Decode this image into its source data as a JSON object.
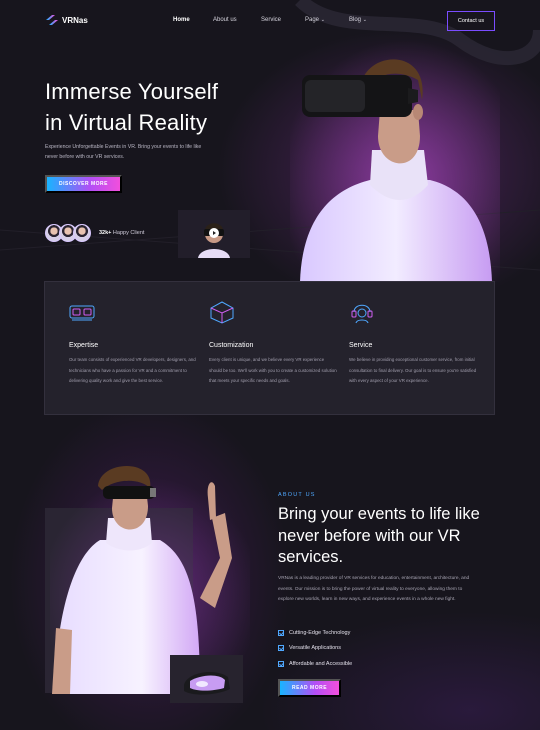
{
  "header": {
    "logo_text": "VRNas",
    "nav": [
      "Home",
      "About us",
      "Service",
      "Page",
      "Blog"
    ],
    "contact_label": "Contact us"
  },
  "hero": {
    "title_line1": "Immerse Yourself",
    "title_line2": "in Virtual Reality",
    "subtitle": "Experience Unforgettable Events in VR. Bring your events to life like never before with our VR services.",
    "cta_label": "DISCOVER MORE",
    "clients_count": "32k+",
    "clients_label": "Happy Client"
  },
  "features": [
    {
      "icon": "vr-headset-icon",
      "title": "Expertise",
      "text": "Our team consists of experienced VR developers, designers, and technicians who have a passion for VR and a commitment to delivering quality work and give the best service."
    },
    {
      "icon": "cube-icon",
      "title": "Customization",
      "text": "Every client is unique, and we believe every VR experience should be too. We'll work with you to create a customized solution that meets your specific needs and goals."
    },
    {
      "icon": "support-person-icon",
      "title": "Service",
      "text": "We believe in providing exceptional customer service, from initial consultation to final delivery. Our goal is to ensure you're satisfied with every aspect of your VR experience."
    }
  ],
  "about": {
    "tag": "ABOUT US",
    "title": "Bring your events to life like never before with our VR services.",
    "text": "VRNas is a leading provider of VR services for education, entertainment, architecture, and events. Our mission is to bring the power of virtual reality to everyone, allowing them to explore new worlds, learn in new ways, and experience events in a whole new fight.",
    "checks": [
      "Cutting-Edge Technology",
      "Versatile Applications",
      "Affordable and Accessible"
    ],
    "cta_label": "READ MORE"
  },
  "colors": {
    "background": "#17151d",
    "accent_blue": "#18b4ff",
    "accent_purple": "#b44ef5",
    "accent_pink": "#f24fdc"
  }
}
